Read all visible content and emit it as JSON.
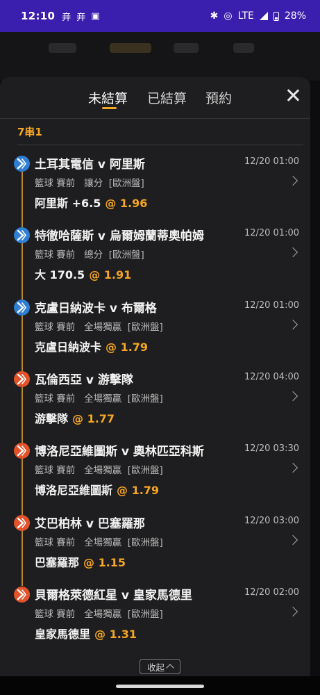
{
  "status_bar": {
    "time": "12:10",
    "notif_icons": [
      "竎",
      "竎"
    ],
    "network": "LTE",
    "battery": "28%"
  },
  "tabs": [
    {
      "label": "未結算",
      "active": true
    },
    {
      "label": "已結算",
      "active": false
    },
    {
      "label": "預約",
      "active": false
    }
  ],
  "parlay_title": "7串1",
  "legs": [
    {
      "match": "土耳其電信 v 阿里斯",
      "time": "12/20 01:00",
      "info": "籃球 賽前   讓分  [歐洲盤]",
      "pick": "阿里斯 +6.5",
      "odds": "@ 1.96",
      "ball": "blue"
    },
    {
      "match": "特徹哈薩斯 v 烏爾姆蘭蒂奧帕姆",
      "time": "12/20 01:00",
      "info": "籃球 賽前   總分  [歐洲盤]",
      "pick": "大 170.5",
      "odds": "@ 1.91",
      "ball": "blue"
    },
    {
      "match": "克盧日納波卡 v 布爾格",
      "time": "12/20 01:00",
      "info": "籃球 賽前   全場獨贏  [歐洲盤]",
      "pick": "克盧日納波卡",
      "odds": "@ 1.79",
      "ball": "blue"
    },
    {
      "match": "瓦倫西亞 v 游擊隊",
      "time": "12/20 04:00",
      "info": "籃球 賽前   全場獨贏  [歐洲盤]",
      "pick": "游擊隊",
      "odds": "@ 1.77",
      "ball": "red"
    },
    {
      "match": "博洛尼亞維圖斯 v 奧林匹亞科斯",
      "time": "12/20 03:30",
      "info": "籃球 賽前   全場獨贏  [歐洲盤]",
      "pick": "博洛尼亞維圖斯",
      "odds": "@ 1.79",
      "ball": "red"
    },
    {
      "match": "艾巴柏林 v 巴塞羅那",
      "time": "12/20 03:00",
      "info": "籃球 賽前   全場獨贏  [歐洲盤]",
      "pick": "巴塞羅那",
      "odds": "@ 1.15",
      "ball": "red"
    },
    {
      "match": "貝爾格萊德紅星 v 皇家馬德里",
      "time": "12/20 02:00",
      "info": "籃球 賽前   全場獨贏  [歐洲盤]",
      "pick": "皇家馬德里",
      "odds": "@ 1.31",
      "ball": "red"
    }
  ],
  "collapse_label": "收起",
  "icons": {
    "close": "close-icon",
    "chevron": "chevron-right-icon",
    "ball": "basketball-euroleague-icon"
  },
  "colors": {
    "accent": "#f5a623",
    "status_bar": "#3a1fae",
    "ball_blue": "#2f7fd6",
    "ball_red": "#e3532b"
  }
}
